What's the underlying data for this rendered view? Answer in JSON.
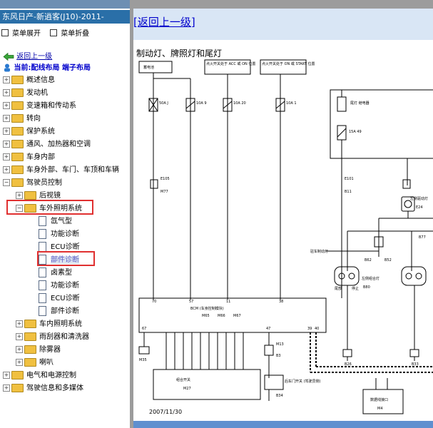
{
  "header": {
    "title": "东风日产-新逍客(J10)-2011-"
  },
  "menu": {
    "expand": "菜单展开",
    "collapse": "菜单折叠"
  },
  "nav": {
    "back": "返回上一级",
    "current": "当前:配线布局 端子布局"
  },
  "tree": [
    {
      "label": "概述信息",
      "level": 0,
      "type": "folder",
      "expanded": false
    },
    {
      "label": "发动机",
      "level": 0,
      "type": "folder",
      "expanded": false
    },
    {
      "label": "变速箱和传动系",
      "level": 0,
      "type": "folder",
      "expanded": false
    },
    {
      "label": "转向",
      "level": 0,
      "type": "folder",
      "expanded": false
    },
    {
      "label": "保护系统",
      "level": 0,
      "type": "folder",
      "expanded": false
    },
    {
      "label": "通风、加热器和空调",
      "level": 0,
      "type": "folder",
      "expanded": false
    },
    {
      "label": "车身内部",
      "level": 0,
      "type": "folder",
      "expanded": false
    },
    {
      "label": "车身外部、车门、车顶和车辆",
      "level": 0,
      "type": "folder",
      "expanded": false
    },
    {
      "label": "驾驶员控制",
      "level": 0,
      "type": "folder",
      "expanded": true
    },
    {
      "label": "后视镜",
      "level": 1,
      "type": "folder",
      "expanded": false
    },
    {
      "label": "车外照明系统",
      "level": 1,
      "type": "folder",
      "expanded": true
    },
    {
      "label": "氙气型",
      "level": 2,
      "type": "page"
    },
    {
      "label": "功能诊断",
      "level": 2,
      "type": "page"
    },
    {
      "label": "ECU诊断",
      "level": 2,
      "type": "page"
    },
    {
      "label": "部件诊断",
      "level": 2,
      "type": "page",
      "selected": true
    },
    {
      "label": "卤素型",
      "level": 2,
      "type": "page"
    },
    {
      "label": "功能诊断",
      "level": 2,
      "type": "page"
    },
    {
      "label": "ECU诊断",
      "level": 2,
      "type": "page"
    },
    {
      "label": "部件诊断",
      "level": 2,
      "type": "page"
    },
    {
      "label": "车内照明系统",
      "level": 1,
      "type": "folder",
      "expanded": false
    },
    {
      "label": "雨刮器和清洗器",
      "level": 1,
      "type": "folder",
      "expanded": false
    },
    {
      "label": "除雾器",
      "level": 1,
      "type": "folder",
      "expanded": false
    },
    {
      "label": "喇叭",
      "level": 1,
      "type": "folder",
      "expanded": false
    },
    {
      "label": "电气和电源控制",
      "level": 0,
      "type": "folder",
      "expanded": false
    },
    {
      "label": "驾驶信息和多媒体",
      "level": 0,
      "type": "folder",
      "expanded": false
    }
  ],
  "content": {
    "back_link": "[返回上一级]",
    "diagram_title": "制动灯、牌照灯和尾灯",
    "date": "2007/11/30",
    "labels": {
      "battery": "蓄电池",
      "ign_acc": "点火开关处于 ACC 或 ON 位置",
      "ign_start": "点火开关处于 ON 或 START 位置",
      "fuse1": "50A J",
      "fuse2": "10A 9",
      "fuse3": "10A 20",
      "fuse4": "10A 1",
      "taillamp_relay": "尾灯 继电器",
      "fuse5": "15A 49",
      "e105": "E105",
      "m77": "M77",
      "e101": "E101",
      "b11": "B11",
      "e24": "E24",
      "rear_comb_lamp": "左侧组合灯",
      "left_side": "左侧驱动灯",
      "b62": "B62",
      "b52": "B52",
      "b77": "B77",
      "b80": "B80",
      "b26": "B26",
      "b33": "B33",
      "parking": "驻车制动灯",
      "tail": "尾部",
      "stop": "停止",
      "bcm": "BCM (车身控制模块)",
      "m65": "M65",
      "m66": "M66",
      "m67": "M67",
      "m35": "M35",
      "m13": "M13",
      "b3": "B3",
      "b34": "B34",
      "m27": "M27",
      "m4": "M4",
      "combination_switch": "组合开关",
      "door_switch": "后车门开关 (驾驶员侧)",
      "dlc": "数据线接口",
      "pin70": "70",
      "pin57": "57",
      "pin11": "11",
      "pin38": "38",
      "pin67": "67",
      "pin47": "47",
      "pin39": "39",
      "pin40": "40"
    }
  },
  "colors": {
    "title_bar": "#2a6fa8",
    "diagram_bg": "#5f8fcf",
    "link": "#0000cc",
    "highlight_box": "#e03030"
  }
}
